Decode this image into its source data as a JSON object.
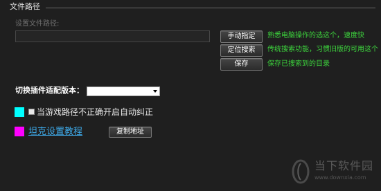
{
  "file_path_section": {
    "title": "文件路径",
    "path_label": "设置文件路径:",
    "path_value": ""
  },
  "buttons": {
    "manual": "手动指定",
    "locate": "定位搜索",
    "save": "保存"
  },
  "hints": {
    "manual": "熟悉电脑操作的选这个，速度快",
    "locate": "传统搜索功能，习惯旧版的可用这个",
    "save": "保存已搜索到的目录"
  },
  "version": {
    "label": "切换插件适配版本：",
    "selected": ""
  },
  "auto_fix": {
    "label": "当游戏路径不正确开启自动纠正",
    "checked": false,
    "color": "#00ffff"
  },
  "tutorial": {
    "link": "坦克设置教程",
    "copy_button": "复制地址",
    "color": "#ff00ff"
  },
  "watermark": {
    "text": "当下软件园",
    "url": "www.downxia.com"
  }
}
